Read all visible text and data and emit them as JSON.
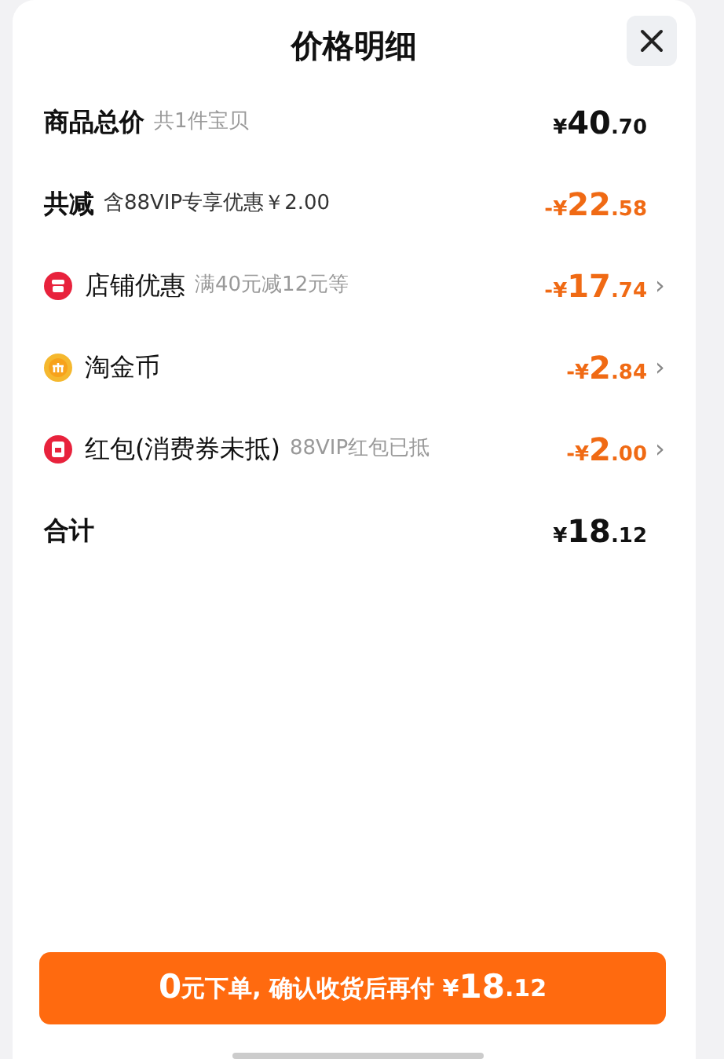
{
  "title": "价格明细",
  "rows": [
    {
      "kind": "subtotal",
      "label": "商品总价",
      "note": "共1件宝贝",
      "amount": {
        "prefix": "¥",
        "whole": "40",
        "fraction": ".70"
      }
    },
    {
      "kind": "saving",
      "label": "共减",
      "note": "含88VIP专享优惠￥2.00",
      "amount": {
        "prefix": "-¥",
        "whole": "22",
        "fraction": ".58"
      }
    },
    {
      "kind": "shop",
      "label": "店铺优惠",
      "note": "满40元减12元等",
      "amount": {
        "prefix": "-¥",
        "whole": "17",
        "fraction": ".74"
      },
      "chevron": "›"
    },
    {
      "kind": "coin",
      "label": "淘金币",
      "amount": {
        "prefix": "-¥",
        "whole": "2",
        "fraction": ".84"
      },
      "chevron": "›"
    },
    {
      "kind": "packet",
      "label": "红包(消费券未抵)",
      "note": "88VIP红包已抵",
      "amount": {
        "prefix": "-¥",
        "whole": "2",
        "fraction": ".00"
      },
      "chevron": "›"
    },
    {
      "kind": "total",
      "label": "合计",
      "amount": {
        "prefix": "¥",
        "whole": "18",
        "fraction": ".12"
      }
    }
  ],
  "button": {
    "parts": [
      {
        "kind": "numeral",
        "text": "0"
      },
      {
        "kind": "words",
        "text": "元下单, 确认收货后再付 ¥"
      },
      {
        "kind": "numeral",
        "text": "18"
      },
      {
        "kind": "words",
        "text": ".12"
      }
    ]
  }
}
